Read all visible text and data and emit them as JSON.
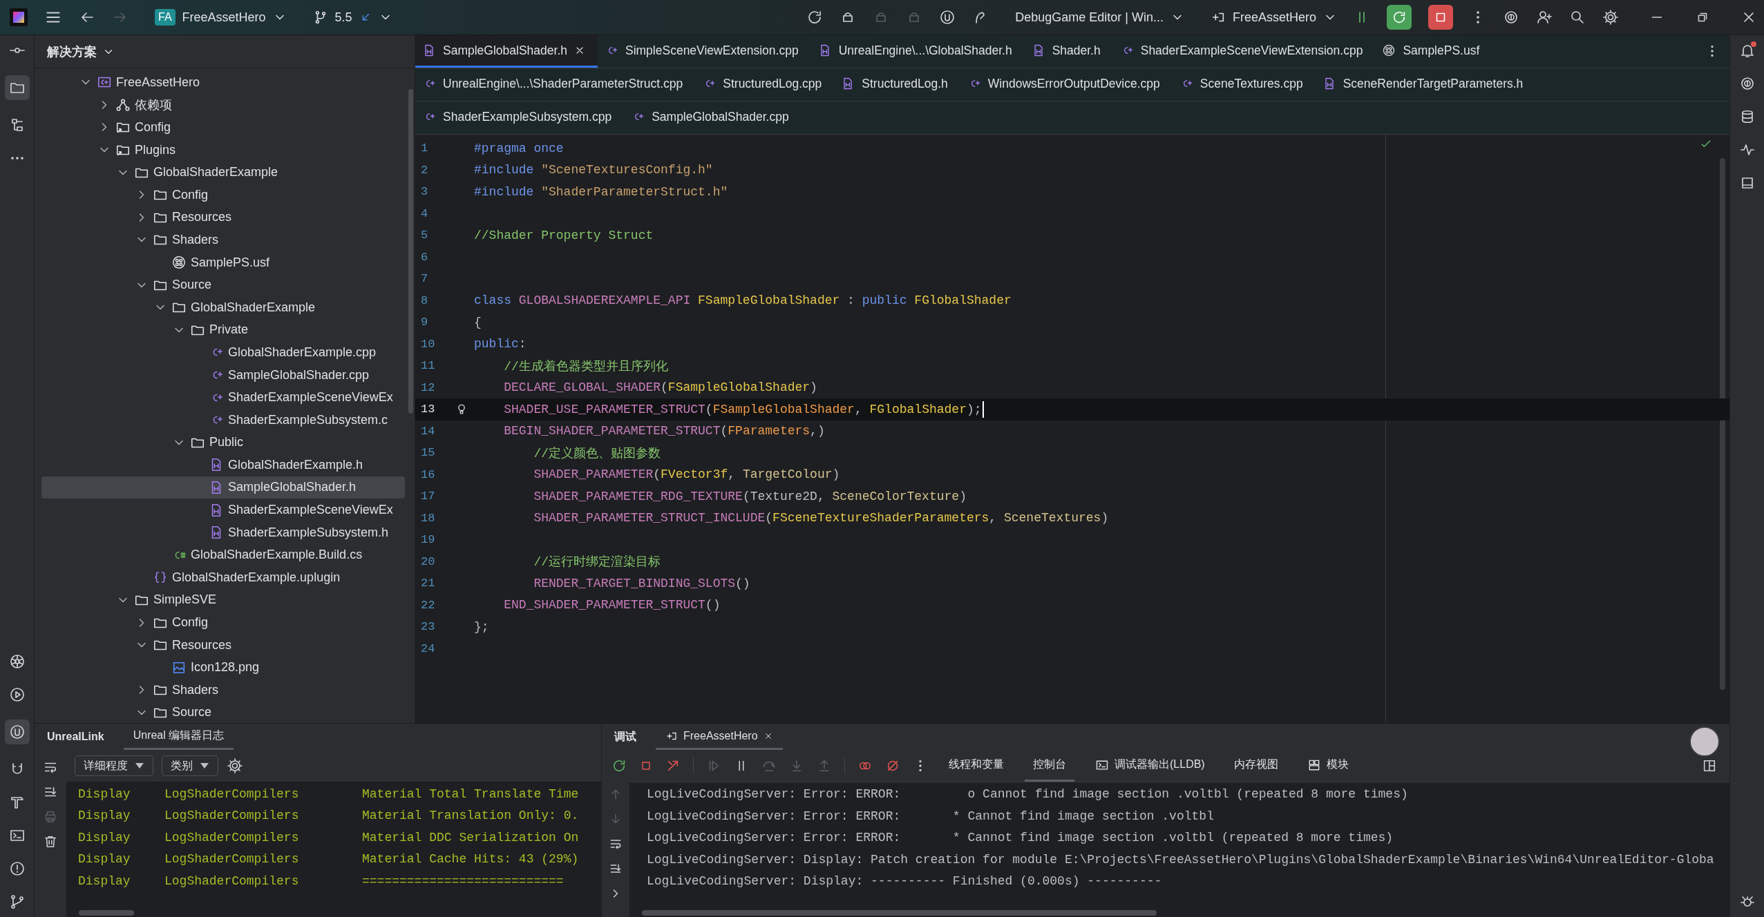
{
  "titlebar": {
    "project_badge": "FA",
    "project": "FreeAssetHero",
    "branch": "5.5",
    "run_config": "DebugGame Editor | Win...",
    "run_target": "FreeAssetHero"
  },
  "solution_panel": {
    "title": "解决方案",
    "tree": [
      {
        "label": "FreeAssetHero",
        "kind": "project",
        "expanded": true,
        "selected": false,
        "children": [
          {
            "label": "依赖项",
            "kind": "deps",
            "expanded": false,
            "selected": false
          },
          {
            "label": "Config",
            "kind": "linked-folder",
            "expanded": false,
            "selected": false
          },
          {
            "label": "Plugins",
            "kind": "linked-folder",
            "expanded": true,
            "selected": false,
            "children": [
              {
                "label": "GlobalShaderExample",
                "kind": "folder",
                "expanded": true,
                "selected": false,
                "children": [
                  {
                    "label": "Config",
                    "kind": "folder",
                    "expanded": false,
                    "selected": false
                  },
                  {
                    "label": "Resources",
                    "kind": "folder",
                    "expanded": false,
                    "selected": false
                  },
                  {
                    "label": "Shaders",
                    "kind": "folder",
                    "expanded": true,
                    "selected": false,
                    "children": [
                      {
                        "label": "SamplePS.usf",
                        "kind": "shader",
                        "selected": false
                      }
                    ]
                  },
                  {
                    "label": "Source",
                    "kind": "folder",
                    "expanded": true,
                    "selected": false,
                    "children": [
                      {
                        "label": "GlobalShaderExample",
                        "kind": "folder",
                        "expanded": true,
                        "selected": false,
                        "children": [
                          {
                            "label": "Private",
                            "kind": "folder",
                            "expanded": true,
                            "selected": false,
                            "children": [
                              {
                                "label": "GlobalShaderExample.cpp",
                                "kind": "cpp",
                                "selected": false
                              },
                              {
                                "label": "SampleGlobalShader.cpp",
                                "kind": "cpp",
                                "selected": false
                              },
                              {
                                "label": "ShaderExampleSceneViewEx",
                                "kind": "cpp",
                                "selected": false
                              },
                              {
                                "label": "ShaderExampleSubsystem.c",
                                "kind": "cpp",
                                "selected": false
                              }
                            ]
                          },
                          {
                            "label": "Public",
                            "kind": "folder",
                            "expanded": true,
                            "selected": false,
                            "children": [
                              {
                                "label": "GlobalShaderExample.h",
                                "kind": "h",
                                "selected": false
                              },
                              {
                                "label": "SampleGlobalShader.h",
                                "kind": "h",
                                "selected": true
                              },
                              {
                                "label": "ShaderExampleSceneViewEx",
                                "kind": "h",
                                "selected": false
                              },
                              {
                                "label": "ShaderExampleSubsystem.h",
                                "kind": "h",
                                "selected": false
                              }
                            ]
                          }
                        ]
                      },
                      {
                        "label": "GlobalShaderExample.Build.cs",
                        "kind": "cs",
                        "selected": false
                      }
                    ]
                  },
                  {
                    "label": "GlobalShaderExample.uplugin",
                    "kind": "uplugin",
                    "selected": false
                  }
                ]
              },
              {
                "label": "SimpleSVE",
                "kind": "folder",
                "expanded": true,
                "selected": false,
                "children": [
                  {
                    "label": "Config",
                    "kind": "folder",
                    "expanded": false,
                    "selected": false
                  },
                  {
                    "label": "Resources",
                    "kind": "folder",
                    "expanded": true,
                    "selected": false,
                    "children": [
                      {
                        "label": "Icon128.png",
                        "kind": "image",
                        "selected": false
                      }
                    ]
                  },
                  {
                    "label": "Shaders",
                    "kind": "folder",
                    "expanded": false,
                    "selected": false
                  },
                  {
                    "label": "Source",
                    "kind": "folder",
                    "expanded": true,
                    "selected": false
                  }
                ]
              }
            ]
          }
        ]
      }
    ]
  },
  "tab_rows": [
    {
      "tabs": [
        {
          "label": "SampleGlobalShader.h",
          "kind": "h",
          "selected": true
        },
        {
          "label": "SimpleSceneViewExtension.cpp",
          "kind": "cpp",
          "selected": false
        },
        {
          "label": "UnrealEngine\\...\\GlobalShader.h",
          "kind": "h",
          "selected": false
        },
        {
          "label": "Shader.h",
          "kind": "h",
          "selected": false
        },
        {
          "label": "ShaderExampleSceneViewExtension.cpp",
          "kind": "cpp",
          "selected": false
        },
        {
          "label": "SamplePS.usf",
          "kind": "shader",
          "selected": false
        }
      ]
    },
    {
      "tabs": [
        {
          "label": "UnrealEngine\\...\\ShaderParameterStruct.cpp",
          "kind": "cpp",
          "selected": false
        },
        {
          "label": "StructuredLog.cpp",
          "kind": "cpp",
          "selected": false
        },
        {
          "label": "StructuredLog.h",
          "kind": "h",
          "selected": false
        },
        {
          "label": "WindowsErrorOutputDevice.cpp",
          "kind": "cpp",
          "selected": false
        },
        {
          "label": "SceneTextures.cpp",
          "kind": "cpp",
          "selected": false
        },
        {
          "label": "SceneRenderTargetParameters.h",
          "kind": "h",
          "selected": false
        }
      ]
    },
    {
      "tabs": [
        {
          "label": "ShaderExampleSubsystem.cpp",
          "kind": "cpp",
          "selected": false
        },
        {
          "label": "SampleGlobalShader.cpp",
          "kind": "cpp",
          "selected": false
        }
      ]
    }
  ],
  "code_lines": [
    {
      "number": "1",
      "current": false,
      "tokens": [
        {
          "text": "#pragma once",
          "kind": "kw"
        }
      ]
    },
    {
      "number": "2",
      "current": false,
      "tokens": [
        {
          "text": "#include ",
          "kind": "kw"
        },
        {
          "text": "\"SceneTexturesConfig.h\"",
          "kind": "str"
        }
      ]
    },
    {
      "number": "3",
      "current": false,
      "tokens": [
        {
          "text": "#include ",
          "kind": "kw"
        },
        {
          "text": "\"ShaderParameterStruct.h\"",
          "kind": "str"
        }
      ]
    },
    {
      "number": "4",
      "current": false
    },
    {
      "number": "5",
      "current": false,
      "tokens": [
        {
          "text": "//Shader Property Struct",
          "kind": "com"
        }
      ]
    },
    {
      "number": "6",
      "current": false
    },
    {
      "number": "7",
      "current": false
    },
    {
      "number": "8",
      "current": false,
      "tokens": [
        {
          "text": "class ",
          "kind": "kw"
        },
        {
          "text": "GLOBALSHADEREXAMPLE_API ",
          "kind": "macro"
        },
        {
          "text": "FSampleGlobalShader",
          "kind": "type"
        },
        {
          "text": " : ",
          "kind": "plain"
        },
        {
          "text": "public ",
          "kind": "kw"
        },
        {
          "text": "FGlobalShader",
          "kind": "type"
        }
      ]
    },
    {
      "number": "9",
      "current": false,
      "tokens": [
        {
          "text": "{",
          "kind": "plain"
        }
      ]
    },
    {
      "number": "10",
      "current": false,
      "tokens": [
        {
          "text": "public",
          "kind": "kw"
        },
        {
          "text": ":",
          "kind": "plain"
        }
      ]
    },
    {
      "number": "11",
      "current": false,
      "tokens": [
        {
          "text": "    //生成着色器类型并且序列化",
          "kind": "com"
        }
      ]
    },
    {
      "number": "12",
      "current": false,
      "tokens": [
        {
          "text": "    DECLARE_GLOBAL_SHADER",
          "kind": "macro"
        },
        {
          "text": "(",
          "kind": "plain"
        },
        {
          "text": "FSampleGlobalShader",
          "kind": "type"
        },
        {
          "text": ")",
          "kind": "plain"
        }
      ]
    },
    {
      "number": "13",
      "current": true,
      "tokens": [
        {
          "text": "    SHADER_USE_PARAMETER_STRUCT",
          "kind": "macro"
        },
        {
          "text": "(",
          "kind": "plain"
        },
        {
          "text": "FSampleGlobalShader",
          "kind": "ctor"
        },
        {
          "text": ", ",
          "kind": "plain"
        },
        {
          "text": "FGlobalShader",
          "kind": "type"
        },
        {
          "text": ");",
          "kind": "plain"
        }
      ]
    },
    {
      "number": "14",
      "current": false,
      "tokens": [
        {
          "text": "    BEGIN_SHADER_PARAMETER_STRUCT",
          "kind": "macro"
        },
        {
          "text": "(",
          "kind": "plain"
        },
        {
          "text": "FParameters",
          "kind": "ctor"
        },
        {
          "text": ",)",
          "kind": "plain"
        }
      ]
    },
    {
      "number": "15",
      "current": false,
      "tokens": [
        {
          "text": "        //定义颜色、贴图参数",
          "kind": "com"
        }
      ]
    },
    {
      "number": "16",
      "current": false,
      "tokens": [
        {
          "text": "        SHADER_PARAMETER",
          "kind": "macro"
        },
        {
          "text": "(",
          "kind": "plain"
        },
        {
          "text": "FVector3f",
          "kind": "type"
        },
        {
          "text": ", ",
          "kind": "plain"
        },
        {
          "text": "TargetColour",
          "kind": "field"
        },
        {
          "text": ")",
          "kind": "plain"
        }
      ]
    },
    {
      "number": "17",
      "current": false,
      "tokens": [
        {
          "text": "        SHADER_PARAMETER_RDG_TEXTURE",
          "kind": "macro"
        },
        {
          "text": "(Texture2D, ",
          "kind": "plain"
        },
        {
          "text": "SceneColorTexture",
          "kind": "field"
        },
        {
          "text": ")",
          "kind": "plain"
        }
      ]
    },
    {
      "number": "18",
      "current": false,
      "tokens": [
        {
          "text": "        SHADER_PARAMETER_STRUCT_INCLUDE",
          "kind": "macro"
        },
        {
          "text": "(",
          "kind": "plain"
        },
        {
          "text": "FSceneTextureShaderParameters",
          "kind": "type"
        },
        {
          "text": ", ",
          "kind": "plain"
        },
        {
          "text": "SceneTextures",
          "kind": "field"
        },
        {
          "text": ")",
          "kind": "plain"
        }
      ]
    },
    {
      "number": "19",
      "current": false
    },
    {
      "number": "20",
      "current": false,
      "tokens": [
        {
          "text": "        //运行时绑定渲染目标",
          "kind": "com"
        }
      ]
    },
    {
      "number": "21",
      "current": false,
      "tokens": [
        {
          "text": "        RENDER_TARGET_BINDING_SLOTS",
          "kind": "macro"
        },
        {
          "text": "()",
          "kind": "plain"
        }
      ]
    },
    {
      "number": "22",
      "current": false,
      "tokens": [
        {
          "text": "    END_SHADER_PARAMETER_STRUCT",
          "kind": "macro"
        },
        {
          "text": "()",
          "kind": "plain"
        }
      ]
    },
    {
      "number": "23",
      "current": false,
      "tokens": [
        {
          "text": "};",
          "kind": "plain"
        }
      ]
    },
    {
      "number": "24",
      "current": false
    }
  ],
  "log_panel": {
    "title": "UnrealLink",
    "tabs": [
      {
        "label": "Unreal 编辑器日志",
        "selected": true
      }
    ],
    "filters": [
      "详细程度",
      "类别"
    ],
    "rows": [
      {
        "level": "Display",
        "category": "LogShaderCompilers",
        "message": "Material Total Translate Time"
      },
      {
        "level": "Display",
        "category": "LogShaderCompilers",
        "message": "Material Translation Only: 0."
      },
      {
        "level": "Display",
        "category": "LogShaderCompilers",
        "message": "Material DDC Serialization On"
      },
      {
        "level": "Display",
        "category": "LogShaderCompilers",
        "message": "Material Cache Hits: 43 (29%)"
      },
      {
        "level": "Display",
        "category": "LogShaderCompilers",
        "message": "==========================="
      }
    ]
  },
  "debug_panel": {
    "title": "调试",
    "tabs": [
      {
        "label": "FreeAssetHero",
        "selected": true
      }
    ],
    "subtabs": [
      {
        "label": "线程和变量",
        "selected": false
      },
      {
        "label": "控制台",
        "selected": true
      },
      {
        "label": "调试器输出(LLDB)",
        "selected": false
      },
      {
        "label": "内存视图",
        "selected": false
      },
      {
        "label": "模块",
        "selected": false
      }
    ],
    "lines": [
      "LogLiveCodingServer: Error: ERROR:         o Cannot find image section .voltbl (repeated 8 more times)",
      "LogLiveCodingServer: Error: ERROR:       * Cannot find image section .voltbl",
      "LogLiveCodingServer: Error: ERROR:       * Cannot find image section .voltbl (repeated 8 more times)",
      "LogLiveCodingServer: Display: Patch creation for module E:\\Projects\\FreeAssetHero\\Plugins\\GlobalShaderExample\\Binaries\\Win64\\UnrealEditor-Globa",
      "LogLiveCodingServer: Display: ---------- Finished (0.000s) ----------"
    ]
  }
}
